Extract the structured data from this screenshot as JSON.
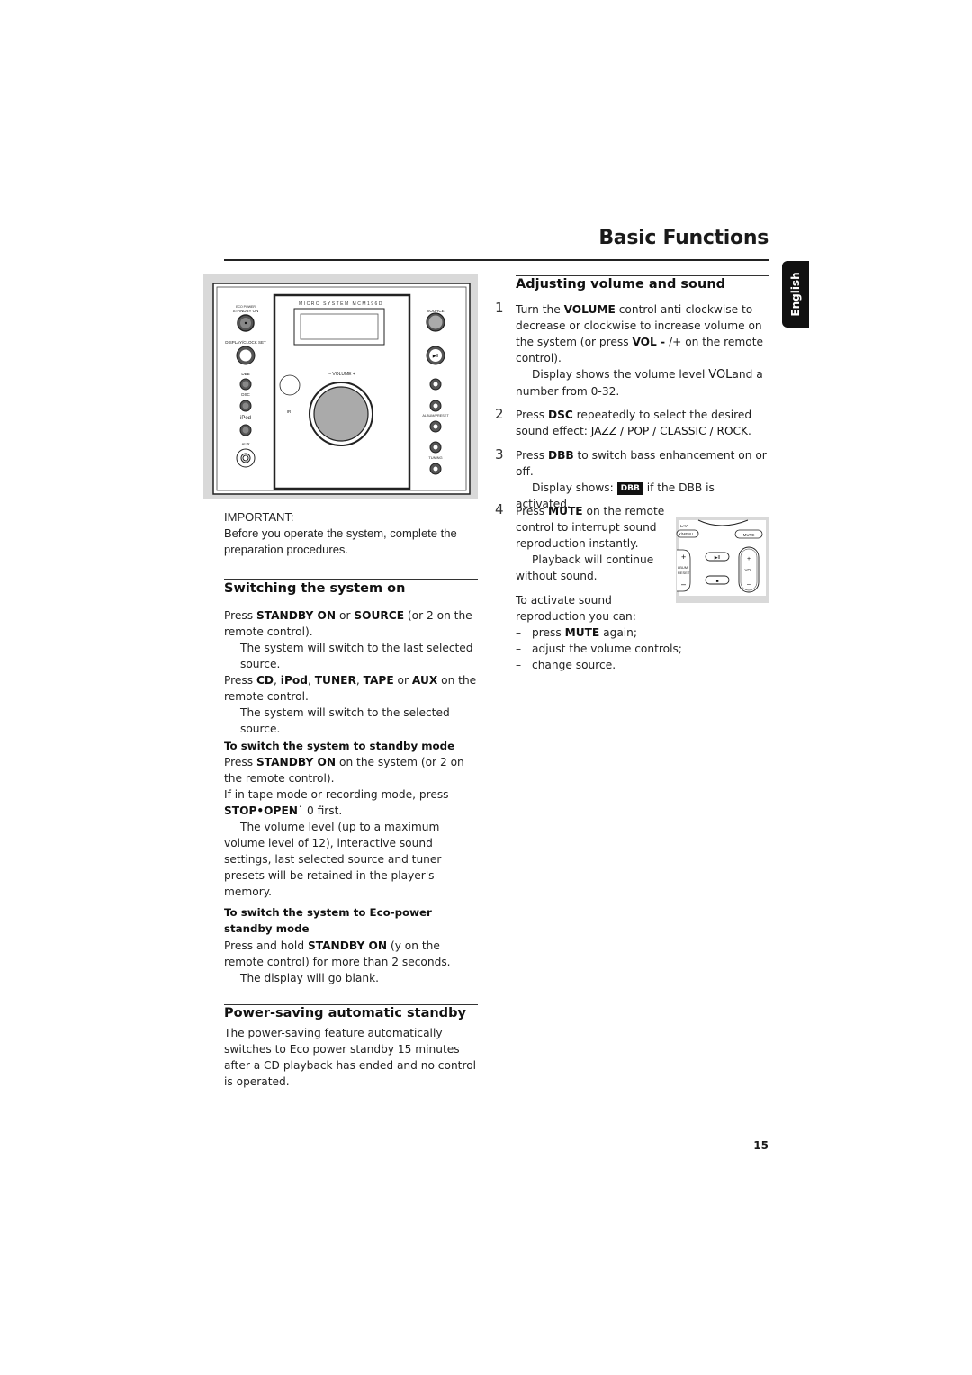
{
  "header": {
    "title": "Basic Functions",
    "language_tab": "English"
  },
  "device_illustration": {
    "model_label": "MICRO SYSTEM MCM196D",
    "left_labels": [
      "ECO POWER",
      "STANDBY ON",
      "DISPLAY/CLOCK SET",
      "DBB",
      "DSC",
      "iPod",
      "AUX"
    ],
    "center_labels": [
      "–  VOLUME  +",
      "IR"
    ],
    "right_labels": [
      "SOURCE",
      "ALBUM/PRESET",
      "TUNING"
    ]
  },
  "important": {
    "label": "IMPORTANT:",
    "text": "Before you operate the system, complete the preparation procedures."
  },
  "switching_on": {
    "heading": "Switching the system on",
    "p1_a": "Press ",
    "p1_b1": "STANDBY ON",
    "p1_c": " or ",
    "p1_b2": "SOURCE",
    "p1_d": " (or 2  on the remote control).",
    "p2": "The system will switch to the last selected source.",
    "p3_a": "Press ",
    "p3_b1": "CD",
    "p3_s1": ", ",
    "p3_b2": "iPod",
    "p3_s2": ", ",
    "p3_b3": "TUNER",
    "p3_s3": ", ",
    "p3_b4": "TAPE",
    "p3_s4": " or ",
    "p3_b5": "AUX",
    "p3_e": " on the remote control.",
    "p4": "The system will switch to the selected source."
  },
  "standby": {
    "heading": "To switch the system to standby mode",
    "p1_a": "Press ",
    "p1_b": "STANDBY ON",
    "p1_c": " on the system (or 2  on the  remote control).",
    "p2": "If in tape mode or recording mode, press",
    "p3_b": "STOP•OPEN˙",
    "p3_c": "  0  first.",
    "p4": "The volume level (up to a maximum volume level of 12), interactive sound settings, last selected source and tuner presets will be retained in the player's memory."
  },
  "eco_standby": {
    "heading": "To switch the system to Eco-power standby mode",
    "p1_a": "Press and hold ",
    "p1_b": "STANDBY ON",
    "p1_c": " (y  on the remote control) for more than 2 seconds.",
    "p2": "The display will go blank."
  },
  "power_saving": {
    "heading": "Power-saving automatic standby",
    "text": "The power-saving feature automatically switches to Eco power standby 15 minutes after a CD playback has ended and no control is operated."
  },
  "volume": {
    "heading": "Adjusting volume and sound",
    "steps": [
      {
        "num": "1",
        "a": "Turn the ",
        "b1": "VOLUME",
        "c": " control anti-clockwise to decrease or clockwise to increase volume on the system (or press ",
        "b2": "VOL -",
        "d": "   /+    on the remote control).",
        "note_a": "Display shows the volume level ",
        "note_b": "VOL",
        "note_c": "and a number from 0-32."
      },
      {
        "num": "2",
        "a": "Press ",
        "b1": "DSC",
        "c": " repeatedly to select the desired sound effect: ",
        "effects": "JAZZ / POP / CLASSIC / ROCK",
        "e": "."
      },
      {
        "num": "3",
        "a": "Press ",
        "b1": "DBB",
        "c": " to switch bass enhancement on or off.",
        "note_a": "Display shows: ",
        "badge": "DBB",
        "note_c": " if the DBB is activated."
      },
      {
        "num": "4",
        "a": "Press ",
        "b1": "MUTE",
        "c": " on the remote control to interrupt sound reproduction instantly.",
        "note": "Playback will continue without sound."
      }
    ],
    "activate_intro": "To activate sound reproduction you can:",
    "activate_items": [
      {
        "a": "press ",
        "b": "MUTE",
        "c": " again;"
      },
      {
        "a": "adjust the volume controls;"
      },
      {
        "a": "change source."
      }
    ]
  },
  "remote_illustration": {
    "labels": [
      "LAY",
      "X/MENU",
      "MUTE",
      "+",
      "LBUM",
      "RESET",
      "–",
      "▶II",
      "■",
      "+",
      "VOL",
      "–"
    ]
  },
  "footer": {
    "page_number": "15"
  }
}
